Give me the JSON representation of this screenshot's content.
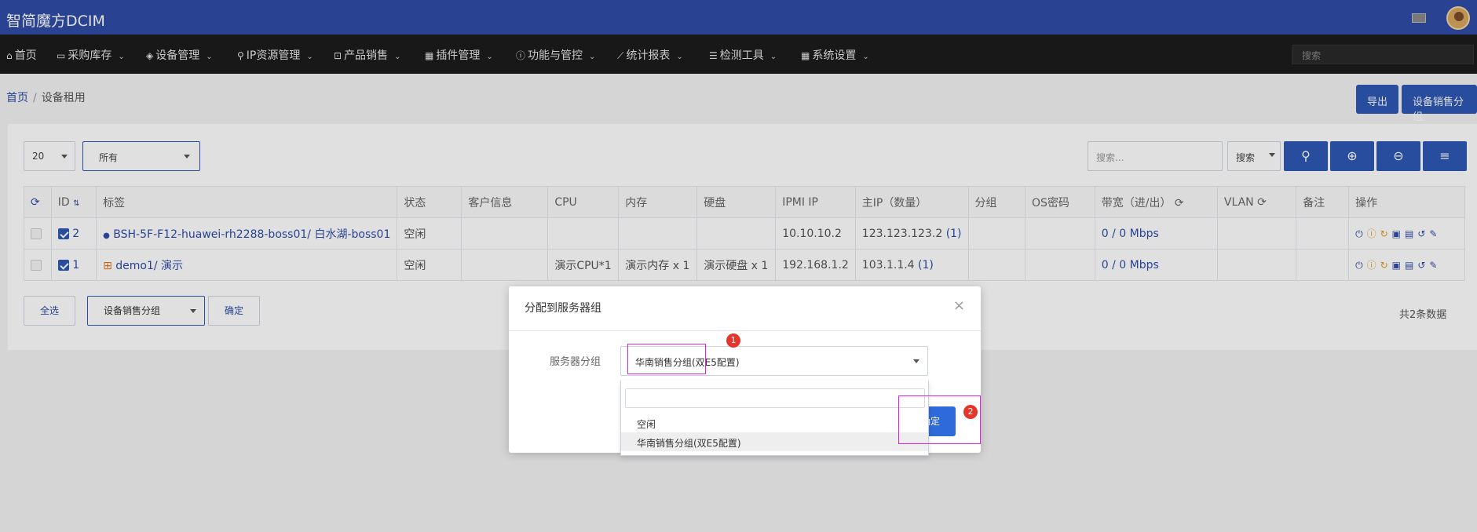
{
  "app": {
    "title": "智简魔方DCIM"
  },
  "nav": {
    "items": [
      {
        "label": "首页",
        "icon": "home-icon",
        "glyph": "⌂"
      },
      {
        "label": "采购库存",
        "icon": "inbox-icon",
        "glyph": "▭"
      },
      {
        "label": "设备管理",
        "icon": "cube-icon",
        "glyph": "◈"
      },
      {
        "label": "IP资源管理",
        "icon": "map-marker-icon",
        "glyph": "⚲"
      },
      {
        "label": "产品销售",
        "icon": "cart-icon",
        "glyph": "⊡"
      },
      {
        "label": "插件管理",
        "icon": "th-icon",
        "glyph": "▦"
      },
      {
        "label": "功能与管控",
        "icon": "info-icon",
        "glyph": "ⓘ"
      },
      {
        "label": "统计报表",
        "icon": "line-chart-icon",
        "glyph": "📈"
      },
      {
        "label": "检测工具",
        "icon": "list-icon",
        "glyph": "☰"
      },
      {
        "label": "系统设置",
        "icon": "grid-icon",
        "glyph": "▦"
      }
    ],
    "search_placeholder": "搜索"
  },
  "breadcrumb": {
    "home": "首页",
    "current": "设备租用"
  },
  "top_buttons": {
    "export": "导出",
    "sale_group": "设备销售分组"
  },
  "toolbar": {
    "page_size": "20",
    "filter_value": "所有",
    "search_placeholder": "搜索...",
    "search_mode": "搜索",
    "search_icon": "search-icon",
    "zoom_in_icon": "zoom-in-icon",
    "zoom_out_icon": "zoom-out-icon",
    "menu_icon": "bars-icon"
  },
  "table": {
    "headers": [
      "",
      "ID",
      "标签",
      "状态",
      "客户信息",
      "CPU",
      "内存",
      "硬盘",
      "IPMI IP",
      "主IP（数量）",
      "分组",
      "OS密码",
      "带宽（进/出）",
      "VLAN",
      "备注",
      "操作"
    ],
    "rows": [
      {
        "id": "2",
        "label": "BSH-5F-F12-huawei-rh2288-boss01/ 白水湖-boss01",
        "os_icon": "circle-icon",
        "status": "空闲",
        "customer": "",
        "cpu": "",
        "memory": "",
        "disk": "",
        "ipmi": "10.10.10.2",
        "main_ip": "123.123.123.2",
        "ip_count": "(1)",
        "group": "",
        "os_pwd": "",
        "bandwidth": "0 / 0 Mbps",
        "vlan": "",
        "note": ""
      },
      {
        "id": "1",
        "label": "demo1/ 演示",
        "os_icon": "windows-icon",
        "status": "空闲",
        "customer": "",
        "cpu": "演示CPU*1",
        "memory": "演示内存 x 1",
        "disk": "演示硬盘 x 1",
        "ipmi": "192.168.1.2",
        "main_ip": "103.1.1.4",
        "ip_count": "(1)",
        "group": "",
        "os_pwd": "",
        "bandwidth": "0 / 0 Mbps",
        "vlan": "",
        "note": ""
      }
    ],
    "total": "共2条数据"
  },
  "bottom": {
    "select_all": "全选",
    "group_select": "设备销售分组",
    "confirm": "确定"
  },
  "modal": {
    "title": "分配到服务器组",
    "field_label": "服务器分组",
    "selected_value": "华南销售分组(双E5配置)",
    "options": [
      "空闲",
      "华南销售分组(双E5配置)"
    ],
    "ok_label": "确定"
  },
  "annotations": {
    "badge1": "1",
    "badge2": "2"
  },
  "colors": {
    "topbar": "#2f4da7",
    "nav": "#1c1c1c",
    "primary": "#2e58b6",
    "highlight": "#e020e0",
    "badge": "#e5362c"
  }
}
